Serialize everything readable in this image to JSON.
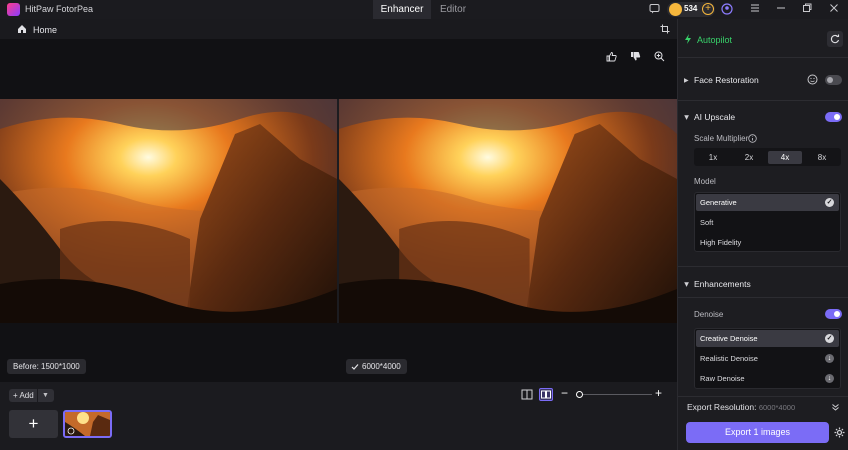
{
  "app": {
    "title": "HitPaw FotorPea",
    "tabs": [
      "Enhancer",
      "Editor"
    ],
    "coins": "534"
  },
  "nav": {
    "home": "Home"
  },
  "canvas": {
    "before_badge": "Before: 1500*1000",
    "after_badge": "6000*4000"
  },
  "bottom": {
    "add_label": "Add",
    "plus": "+"
  },
  "panel": {
    "autopilot": "Autopilot",
    "face_restoration": "Face Restoration",
    "ai_upscale": "AI Upscale",
    "scale_multiplier": "Scale Multiplier",
    "scales": [
      "1x",
      "2x",
      "4x",
      "8x"
    ],
    "selected_scale": "4x",
    "model_label": "Model",
    "models": [
      "Generative",
      "Soft",
      "High Fidelity"
    ],
    "enhancements": "Enhancements",
    "denoise": "Denoise",
    "denoise_options": [
      "Creative Denoise",
      "Realistic Denoise",
      "Raw Denoise"
    ],
    "export_resolution_label": "Export Resolution:",
    "export_resolution_value": "6000*4000",
    "export_button": "Export 1 images"
  },
  "colors": {
    "accent": "#7b6cf6",
    "autopilot": "#38d26a"
  }
}
